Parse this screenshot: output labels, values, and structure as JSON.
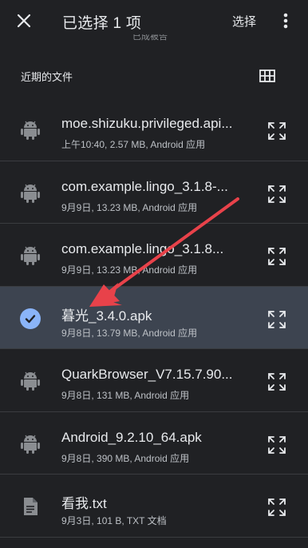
{
  "topbar": {
    "close_icon": "close-icon",
    "title": "已选择 1 项",
    "select_label": "选择",
    "more_icon": "more-vert-icon"
  },
  "ghost_text": "已成被告",
  "section": {
    "title": "近期的文件",
    "grid_icon": "grid-view-icon"
  },
  "files": [
    {
      "name": "moe.shizuku.privileged.api...",
      "meta": "上午10:40, 2.57 MB, Android 应用",
      "icon": "android-icon",
      "selected": false
    },
    {
      "name": "com.example.lingo_3.1.8-...",
      "meta": "9月9日, 13.23 MB, Android 应用",
      "icon": "android-icon",
      "selected": false
    },
    {
      "name": "com.example.lingo_3.1.8...",
      "meta": "9月9日, 13.23 MB, Android 应用",
      "icon": "android-icon",
      "selected": false
    },
    {
      "name": "暮光_3.4.0.apk",
      "meta": "9月8日, 13.79 MB, Android 应用",
      "icon": "check-circle-icon",
      "selected": true
    },
    {
      "name": "QuarkBrowser_V7.15.7.90...",
      "meta": "9月8日, 131 MB, Android 应用",
      "icon": "android-icon",
      "selected": false
    },
    {
      "name": "Android_9.2.10_64.apk",
      "meta": "9月8日, 390 MB, Android 应用",
      "icon": "android-icon",
      "selected": false
    },
    {
      "name": "看我.txt",
      "meta": "9月3日, 101 B, TXT 文档",
      "icon": "text-document-icon",
      "selected": false
    }
  ],
  "colors": {
    "background": "#202124",
    "selected_row": "#3d4450",
    "accent": "#8ab4f8",
    "annotation_arrow": "#e8424a"
  }
}
